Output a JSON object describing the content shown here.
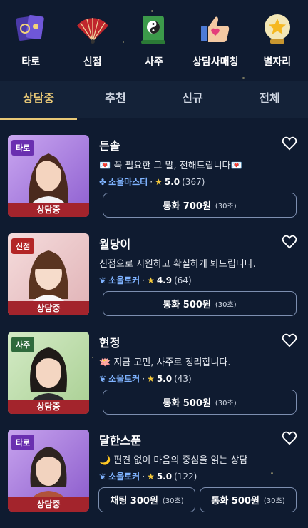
{
  "categories": [
    {
      "label": "타로",
      "icon": "tarot-cards-icon"
    },
    {
      "label": "신점",
      "icon": "fan-icon"
    },
    {
      "label": "사주",
      "icon": "yinyang-scroll-icon"
    },
    {
      "label": "상담사매칭",
      "icon": "thumbs-up-heart-icon"
    },
    {
      "label": "별자리",
      "icon": "star-crystal-ball-icon"
    }
  ],
  "tabs": [
    {
      "label": "상담중",
      "active": true
    },
    {
      "label": "추천",
      "active": false
    },
    {
      "label": "신규",
      "active": false
    },
    {
      "label": "전체",
      "active": false
    }
  ],
  "counselors": [
    {
      "tag": "타로",
      "status": "상담중",
      "name": "든솔",
      "desc": "💌 꼭 필요한 그 말, 전해드립니다💌",
      "grade": "소울마스터",
      "rating": "5.0",
      "count": "(367)",
      "buttons": [
        {
          "label": "통화 700원",
          "unit": "(30초)"
        }
      ]
    },
    {
      "tag": "신점",
      "status": "상담중",
      "name": "월당이",
      "desc": "신점으로 시원하고 확실하게 봐드립니다.",
      "grade": "소울토커",
      "rating": "4.9",
      "count": "(64)",
      "buttons": [
        {
          "label": "통화 500원",
          "unit": "(30초)"
        }
      ]
    },
    {
      "tag": "사주",
      "status": "상담중",
      "name": "현정",
      "desc": "🪷 지금 고민, 사주로 정리합니다.",
      "grade": "소울토커",
      "rating": "5.0",
      "count": "(43)",
      "buttons": [
        {
          "label": "통화 500원",
          "unit": "(30초)"
        }
      ]
    },
    {
      "tag": "타로",
      "status": "상담중",
      "name": "달한스푼",
      "desc": "🌙 편견 없이 마음의 중심을 읽는 상담",
      "grade": "소울토커",
      "rating": "5.0",
      "count": "(122)",
      "buttons": [
        {
          "label": "채팅 300원",
          "unit": "(30초)"
        },
        {
          "label": "통화 500원",
          "unit": "(30초)"
        }
      ]
    }
  ],
  "colors": {
    "background": "#0f1b30",
    "accent": "#e8c877",
    "status": "#a3242c",
    "tag_purple": "#6a2fb0",
    "tag_red": "#b32626",
    "tag_green": "#2f6a3c"
  }
}
